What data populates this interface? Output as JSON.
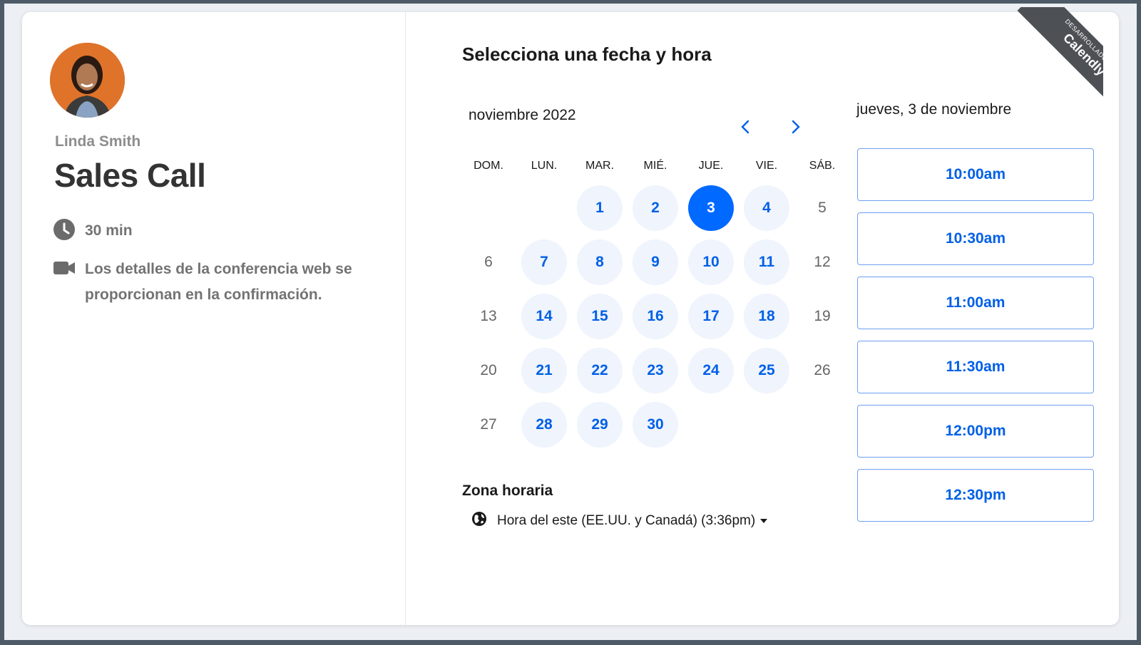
{
  "host": {
    "name": "Linda Smith",
    "event_title": "Sales Call",
    "duration": "30 min",
    "conference_note_line1": "Los detalles de la conferencia web se",
    "conference_note_line2": "proporcionan en la confirmación."
  },
  "scheduler": {
    "heading": "Selecciona una fecha y hora",
    "month_label": "noviembre 2022",
    "weekdays": [
      "DOM.",
      "LUN.",
      "MAR.",
      "MIÉ.",
      "JUE.",
      "VIE.",
      "SÁB."
    ],
    "weeks": [
      [
        {
          "day": "",
          "state": "empty"
        },
        {
          "day": "",
          "state": "empty"
        },
        {
          "day": "1",
          "state": "available"
        },
        {
          "day": "2",
          "state": "available"
        },
        {
          "day": "3",
          "state": "selected"
        },
        {
          "day": "4",
          "state": "available"
        },
        {
          "day": "5",
          "state": "disabled"
        }
      ],
      [
        {
          "day": "6",
          "state": "disabled"
        },
        {
          "day": "7",
          "state": "available"
        },
        {
          "day": "8",
          "state": "available"
        },
        {
          "day": "9",
          "state": "available"
        },
        {
          "day": "10",
          "state": "available"
        },
        {
          "day": "11",
          "state": "available"
        },
        {
          "day": "12",
          "state": "disabled"
        }
      ],
      [
        {
          "day": "13",
          "state": "disabled"
        },
        {
          "day": "14",
          "state": "available"
        },
        {
          "day": "15",
          "state": "available"
        },
        {
          "day": "16",
          "state": "available"
        },
        {
          "day": "17",
          "state": "available"
        },
        {
          "day": "18",
          "state": "available"
        },
        {
          "day": "19",
          "state": "disabled"
        }
      ],
      [
        {
          "day": "20",
          "state": "disabled"
        },
        {
          "day": "21",
          "state": "available"
        },
        {
          "day": "22",
          "state": "available"
        },
        {
          "day": "23",
          "state": "available"
        },
        {
          "day": "24",
          "state": "available"
        },
        {
          "day": "25",
          "state": "available"
        },
        {
          "day": "26",
          "state": "disabled"
        }
      ],
      [
        {
          "day": "27",
          "state": "disabled"
        },
        {
          "day": "28",
          "state": "available"
        },
        {
          "day": "29",
          "state": "available"
        },
        {
          "day": "30",
          "state": "available"
        },
        {
          "day": "",
          "state": "empty"
        },
        {
          "day": "",
          "state": "empty"
        },
        {
          "day": "",
          "state": "empty"
        }
      ]
    ],
    "timezone_heading": "Zona horaria",
    "timezone_value": "Hora del este (EE.UU. y Canadá) (3:36pm)",
    "selected_date_label": "jueves, 3 de noviembre",
    "time_slots": [
      "10:00am",
      "10:30am",
      "11:00am",
      "11:30am",
      "12:00pm",
      "12:30pm"
    ]
  },
  "badge": {
    "small_text": "DESARROLLADO POR",
    "brand_text": "Calendly"
  },
  "colors": {
    "accent": "#0069ff",
    "available_bg": "#eff4fd",
    "ribbon": "#4d5055"
  },
  "icons": {
    "prev": "chevron-left-icon",
    "next": "chevron-right-icon",
    "duration": "clock-icon",
    "conference": "video-camera-icon",
    "timezone": "globe-icon",
    "timezone_dropdown": "caret-down-icon"
  }
}
